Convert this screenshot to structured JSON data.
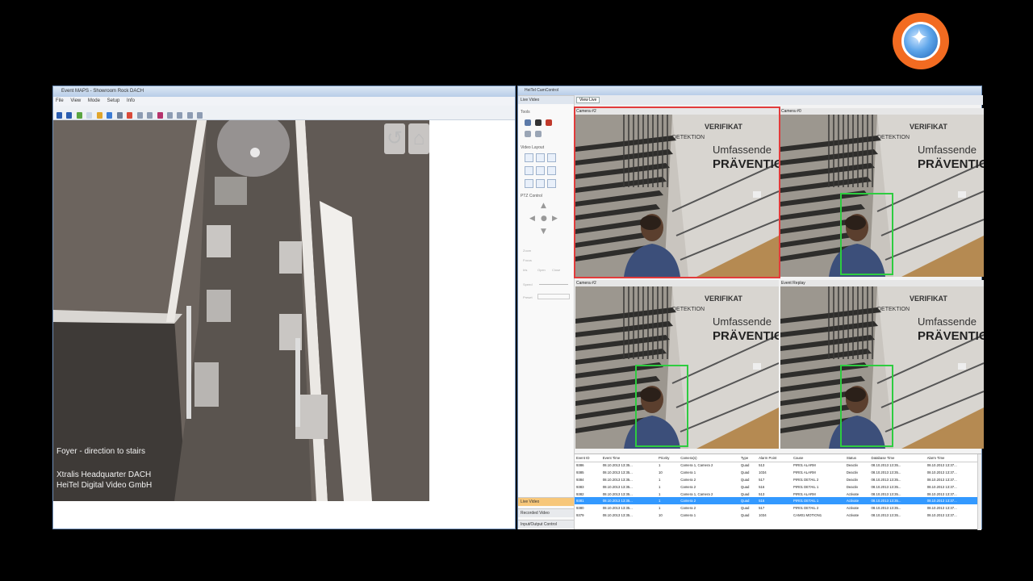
{
  "left_window": {
    "title": "Event MAPS - Showroom Rock DACH",
    "menu": [
      "File",
      "View",
      "Mode",
      "Setup",
      "Info"
    ],
    "map_overlay": {
      "line1": "Foyer - direction to stairs",
      "line2": "Xtralis Headquarter DACH",
      "line3": "HeiTel Digital Video GmbH"
    }
  },
  "right_window": {
    "title": "HeiTel CamControl",
    "toolbar": {
      "view_live_label": "View Live"
    },
    "nav": {
      "top_tab": "Live Video",
      "tools_label": "Tools",
      "video_layout_label": "Video Layout",
      "ptz_label": "PTZ Control",
      "ptz_rows": [
        "Zoom",
        "Focus",
        "Iris"
      ],
      "ptz_buttons": [
        "Open",
        "Close"
      ],
      "speed_label": "Speed",
      "preset_label": "Preset",
      "bottom_tabs": [
        "Live Video",
        "Recorded Video",
        "Input/Output Control"
      ]
    },
    "cameras": [
      {
        "label": "Camera #2",
        "selected": true,
        "box": false
      },
      {
        "label": "Camera #0",
        "selected": false,
        "box": true
      },
      {
        "label": "Camera #2",
        "selected": false,
        "box": true
      },
      {
        "label": "Event Replay",
        "selected": false,
        "box": true
      }
    ],
    "wall_text": {
      "a": "VERIFIKAT",
      "b": "DETEKTION",
      "c": "Umfassende",
      "d": "PRÄVENTION"
    },
    "events": {
      "columns": [
        "Event ID",
        "Event Time",
        "Priority",
        "Camera(s)",
        "Type",
        "Alarm Point",
        "Cause",
        "Status",
        "Database Time",
        "Alarm Time"
      ],
      "selected_index": 5,
      "rows": [
        [
          "9386",
          "08.10.2013 13:35...",
          "1",
          "Camera 1, Camera 2",
          "Quad",
          "513",
          "PIR01 ALARM",
          "Deactiv",
          "08.10.2013 13:35...",
          "08.10.2013 13:37..."
        ],
        [
          "9385",
          "08.10.2013 13:35...",
          "10",
          "Camera 1",
          "Quad",
          "1034",
          "PIR01 ALARM",
          "Deactiv",
          "08.10.2013 13:35...",
          "08.10.2013 13:37..."
        ],
        [
          "9384",
          "08.10.2013 13:35...",
          "1",
          "Camera 2",
          "Quad",
          "517",
          "PIR01 DETAIL 2",
          "Deactiv",
          "08.10.2013 13:35...",
          "08.10.2013 13:37..."
        ],
        [
          "9383",
          "08.10.2013 13:35...",
          "1",
          "Camera 2",
          "Quad",
          "516",
          "PIR01 DETAIL 1",
          "Deactiv",
          "08.10.2013 13:35...",
          "08.10.2013 13:37..."
        ],
        [
          "9382",
          "08.10.2013 13:35...",
          "1",
          "Camera 1, Camera 2",
          "Quad",
          "513",
          "PIR01 ALARM",
          "Activate",
          "08.10.2013 13:35...",
          "08.10.2013 13:37..."
        ],
        [
          "9381",
          "08.10.2013 13:35...",
          "1",
          "Camera 2",
          "Quad",
          "516",
          "PIR01 DETAIL 1",
          "Activate",
          "08.10.2013 13:35...",
          "08.10.2013 13:37..."
        ],
        [
          "9380",
          "08.10.2013 13:35...",
          "1",
          "Camera 2",
          "Quad",
          "517",
          "PIR01 DETAIL 2",
          "Activate",
          "08.10.2013 13:35...",
          "08.10.2013 13:37..."
        ],
        [
          "9379",
          "08.10.2013 13:35...",
          "10",
          "Camera 1",
          "Quad",
          "1034",
          "CAM01 MOTION1",
          "Activate",
          "08.10.2013 13:35...",
          "08.10.2013 13:37..."
        ]
      ]
    }
  }
}
